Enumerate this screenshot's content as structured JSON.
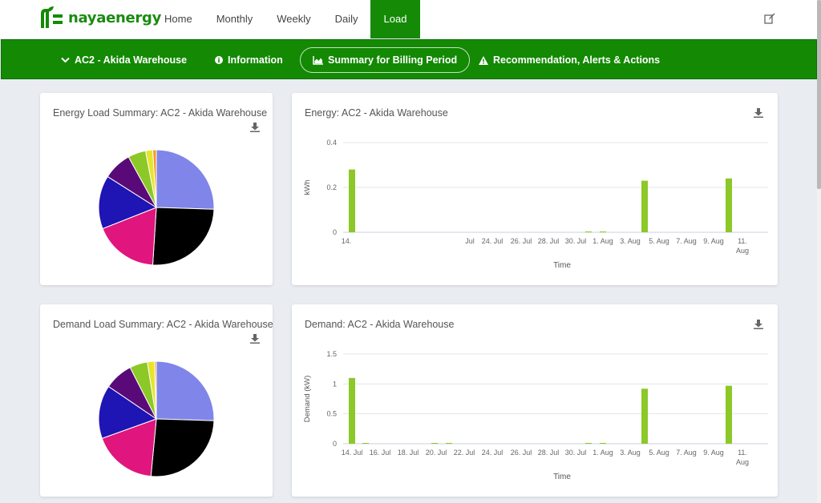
{
  "brand": {
    "logo_naya": "naya",
    "logo_energy": "energy",
    "color": "#148a06"
  },
  "nav": {
    "items": [
      "Home",
      "Monthly",
      "Weekly",
      "Daily",
      "Load"
    ],
    "active": "Load"
  },
  "subnav": {
    "site": "AC2 - Akida Warehouse",
    "information": "Information",
    "summary": "Summary for Billing Period",
    "recommendation": "Recommendation, Alerts & Actions"
  },
  "colors": {
    "bar": "#8cc828",
    "grid": "#e6e6e6",
    "pie": [
      "#8085e9",
      "#000000",
      "#e0157d",
      "#1f14b4",
      "#5a0a78",
      "#8cc828",
      "#e5e52e",
      "#f29c25"
    ]
  },
  "cards": {
    "energy_pie_title": "Energy Load Summary: AC2 - Akida Warehouse",
    "demand_pie_title": "Demand Load Summary: AC2 - Akida Warehouse",
    "energy_bar_title": "Energy: AC2 - Akida Warehouse",
    "demand_bar_title": "Demand: AC2 - Akida Warehouse"
  },
  "chart_data": [
    {
      "id": "energy_pie",
      "type": "pie",
      "values": [
        25.5,
        25.5,
        18,
        15,
        8,
        5,
        2,
        1
      ]
    },
    {
      "id": "demand_pie",
      "type": "pie",
      "values": [
        25.5,
        26,
        18,
        15,
        8,
        5,
        2,
        0.5
      ]
    },
    {
      "id": "energy_bar",
      "type": "bar",
      "ylabel": "kWh",
      "xlabel": "Time",
      "ylim": [
        0,
        0.4
      ],
      "yticks": [
        "0",
        "0.2",
        "0.4"
      ],
      "xtick_labels": [
        "14.",
        "Jul",
        "24. Jul",
        "26. Jul",
        "28. Jul",
        "30. Jul",
        "1. Aug",
        "3. Aug",
        "5. Aug",
        "7. Aug",
        "9. Aug",
        "11. Aug"
      ],
      "values": [
        0.28,
        0.003,
        0.003,
        0.23,
        0.24
      ]
    },
    {
      "id": "demand_bar",
      "type": "bar",
      "ylabel": "Demand (kW)",
      "xlabel": "Time",
      "ylim": [
        0,
        1.5
      ],
      "yticks": [
        "0",
        "0.5",
        "1",
        "1.5"
      ],
      "xtick_labels": [
        "14. Jul",
        "16. Jul",
        "18. Jul",
        "20. Jul",
        "22. Jul",
        "24. Jul",
        "26. Jul",
        "28. Jul",
        "30. Jul",
        "1. Aug",
        "3. Aug",
        "5. Aug",
        "7. Aug",
        "9. Aug",
        "11. Aug"
      ],
      "values": [
        1.1,
        0.01,
        0.01,
        0.01,
        0.01,
        0.01,
        0.92,
        0.97
      ]
    }
  ]
}
